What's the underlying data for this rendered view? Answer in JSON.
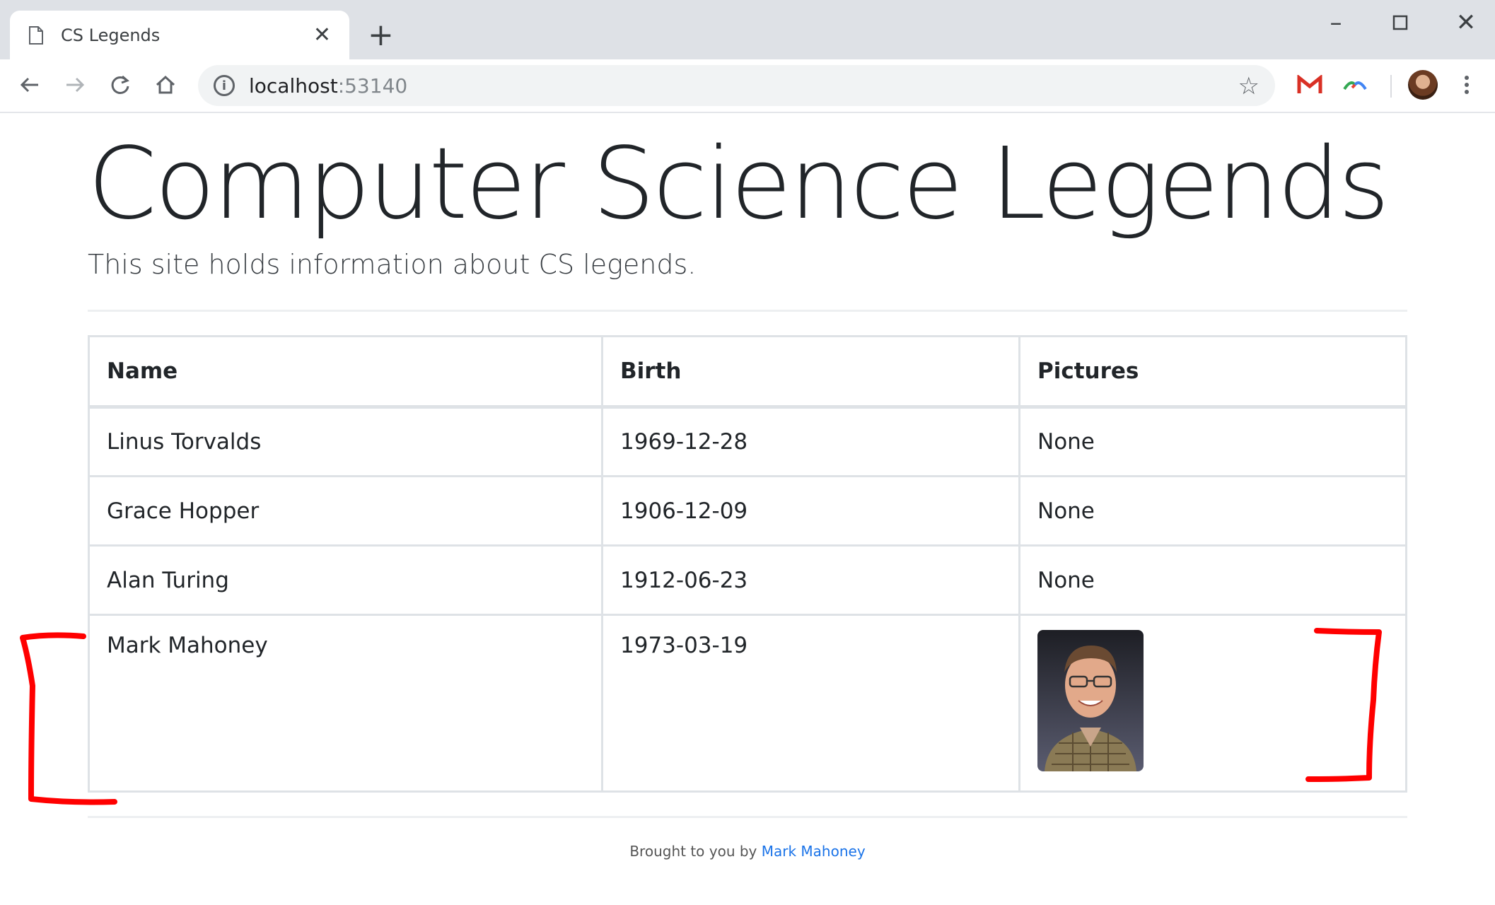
{
  "browser": {
    "tab_title": "CS Legends",
    "new_tab_label": "+",
    "url_host": "localhost",
    "url_port": ":53140"
  },
  "page": {
    "title": "Computer Science Legends",
    "lead": "This site holds information about CS legends."
  },
  "table": {
    "headers": [
      "Name",
      "Birth",
      "Pictures"
    ],
    "rows": [
      {
        "name": "Linus Torvalds",
        "birth": "1969-12-28",
        "picture": "None"
      },
      {
        "name": "Grace Hopper",
        "birth": "1906-12-09",
        "picture": "None"
      },
      {
        "name": "Alan Turing",
        "birth": "1912-06-23",
        "picture": "None"
      },
      {
        "name": "Mark Mahoney",
        "birth": "1973-03-19",
        "picture": "photo"
      }
    ]
  },
  "footer": {
    "prefix": "Brought to you by",
    "link": "Mark Mahoney"
  },
  "colors": {
    "tabstrip": "#dee1e6",
    "link": "#1a73e8",
    "annotation": "#ff0000",
    "table_border": "#dee2e6"
  },
  "icons": [
    "page-icon",
    "close-icon",
    "minimize-icon",
    "maximize-icon",
    "back-icon",
    "forward-icon",
    "reload-icon",
    "home-icon",
    "info-icon",
    "star-icon",
    "gmail-icon",
    "extension-icon",
    "profile-avatar",
    "menu-icon"
  ]
}
